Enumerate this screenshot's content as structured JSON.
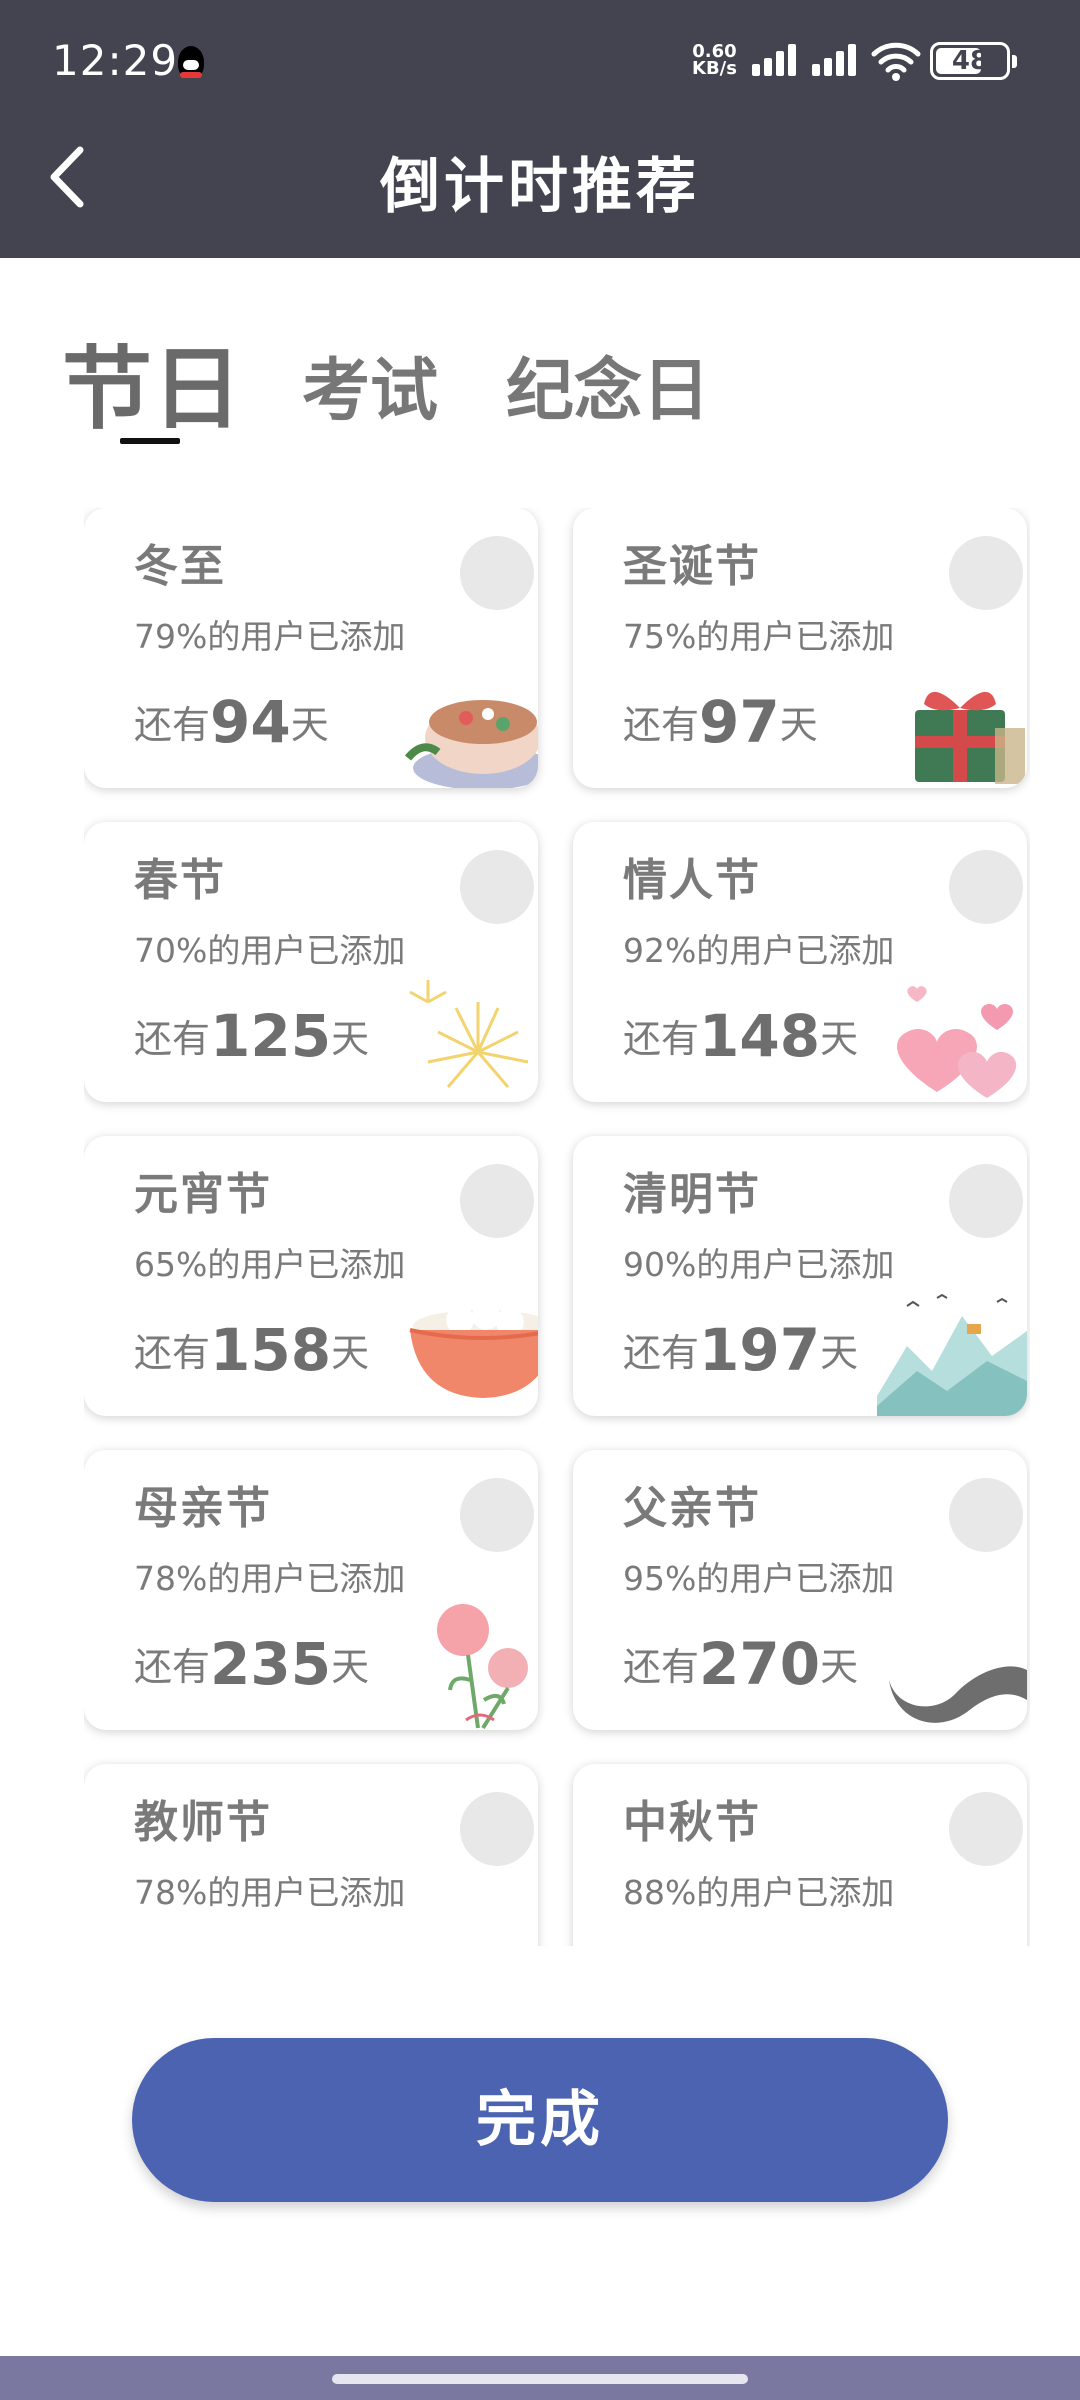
{
  "status_bar": {
    "time": "12:29",
    "net_speed_value": "0.60",
    "net_speed_unit": "KB/s",
    "battery": "48",
    "icons": [
      "qq-icon",
      "signal-icon",
      "signal-icon",
      "wifi-icon",
      "battery-icon"
    ]
  },
  "header": {
    "title": "倒计时推荐",
    "back_icon": "chevron-left-icon",
    "background": "#43444f"
  },
  "tabs": [
    {
      "label": "节日",
      "active": true
    },
    {
      "label": "考试",
      "active": false
    },
    {
      "label": "纪念日",
      "active": false
    }
  ],
  "cards": [
    {
      "name": "冬至",
      "percent_text": "79%的用户已添加",
      "remain_prefix": "还有",
      "days": "94",
      "remain_suffix": "天",
      "illustration": "hotpot-illustration"
    },
    {
      "name": "圣诞节",
      "percent_text": "75%的用户已添加",
      "remain_prefix": "还有",
      "days": "97",
      "remain_suffix": "天",
      "illustration": "gift-box-illustration"
    },
    {
      "name": "春节",
      "percent_text": "70%的用户已添加",
      "remain_prefix": "还有",
      "days": "125",
      "remain_suffix": "天",
      "illustration": "fireworks-illustration"
    },
    {
      "name": "情人节",
      "percent_text": "92%的用户已添加",
      "remain_prefix": "还有",
      "days": "148",
      "remain_suffix": "天",
      "illustration": "hearts-illustration"
    },
    {
      "name": "元宵节",
      "percent_text": "65%的用户已添加",
      "remain_prefix": "还有",
      "days": "158",
      "remain_suffix": "天",
      "illustration": "tangyuan-bowl-illustration"
    },
    {
      "name": "清明节",
      "percent_text": "90%的用户已添加",
      "remain_prefix": "还有",
      "days": "197",
      "remain_suffix": "天",
      "illustration": "mountains-illustration"
    },
    {
      "name": "母亲节",
      "percent_text": "78%的用户已添加",
      "remain_prefix": "还有",
      "days": "235",
      "remain_suffix": "天",
      "illustration": "carnation-illustration"
    },
    {
      "name": "父亲节",
      "percent_text": "95%的用户已添加",
      "remain_prefix": "还有",
      "days": "270",
      "remain_suffix": "天",
      "illustration": "mustache-illustration"
    },
    {
      "name": "教师节",
      "percent_text": "78%的用户已添加",
      "remain_prefix": "",
      "days": "",
      "remain_suffix": "",
      "illustration": "teacher-illustration"
    },
    {
      "name": "中秋节",
      "percent_text": "88%的用户已添加",
      "remain_prefix": "",
      "days": "",
      "remain_suffix": "",
      "illustration": "mooncake-illustration"
    }
  ],
  "done_button": "完成",
  "colors": {
    "header_bg": "#43444f",
    "accent": "#4b63b0",
    "nav_bar": "#7a78a0",
    "checkbox": "#e8e8e8"
  }
}
